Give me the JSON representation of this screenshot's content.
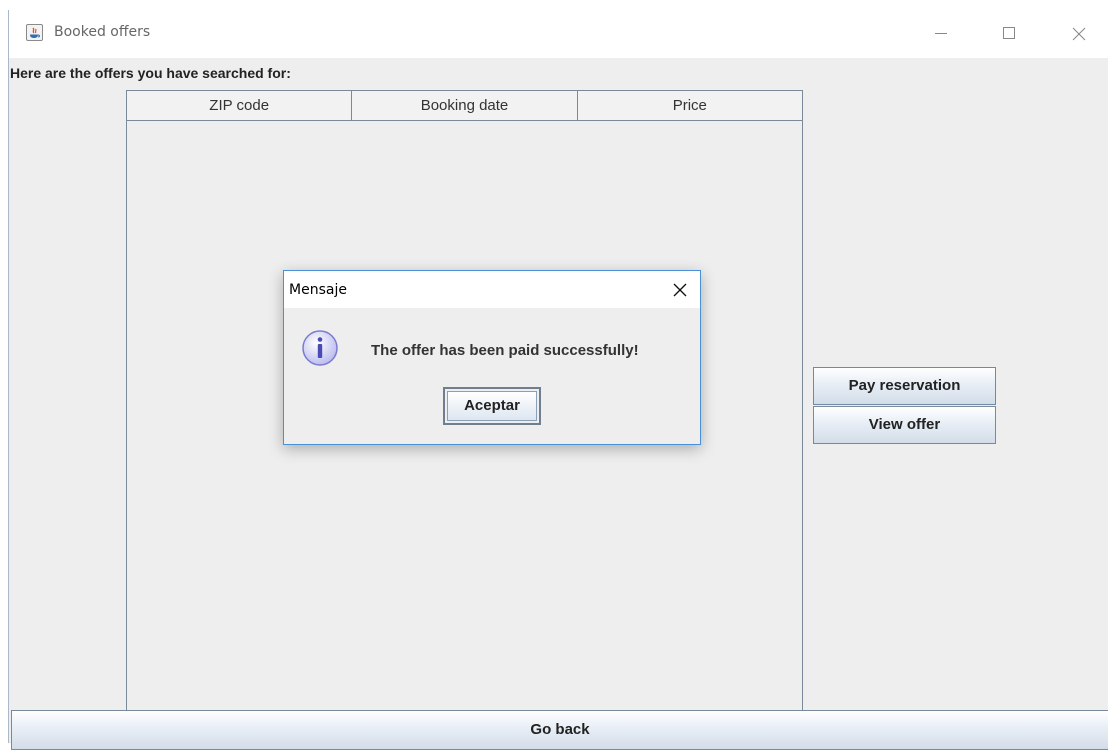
{
  "window": {
    "title": "Booked offers",
    "icon": "java-app-icon",
    "controls": [
      "minimize-icon",
      "maximize-icon",
      "close-icon"
    ]
  },
  "heading": "Here are the offers you have searched for:",
  "table": {
    "columns": [
      "ZIP code",
      "Booking date",
      "Price"
    ],
    "rows": []
  },
  "buttons": {
    "pay": "Pay reservation",
    "view": "View offer",
    "back": "Go back"
  },
  "dialog": {
    "title": "Mensaje",
    "icon": "info-icon",
    "message": "The offer has been paid successfully!",
    "ok": "Aceptar"
  },
  "colors": {
    "window_bg": "#eeeeee",
    "dialog_border": "#4a90d9",
    "button_border": "#7a8a9a"
  }
}
